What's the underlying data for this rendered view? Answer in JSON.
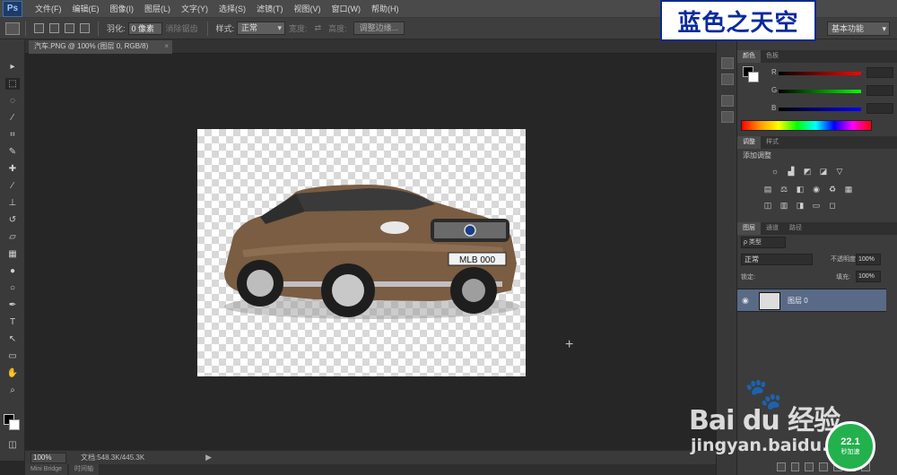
{
  "app": {
    "logo": "Ps"
  },
  "menu": [
    "文件(F)",
    "编辑(E)",
    "图像(I)",
    "图层(L)",
    "文字(Y)",
    "选择(S)",
    "滤镜(T)",
    "视图(V)",
    "窗口(W)",
    "帮助(H)"
  ],
  "options": {
    "feather_label": "羽化:",
    "feather_value": "0 像素",
    "antialias": "消除锯齿",
    "style_label": "样式:",
    "style_value": "正常",
    "width_label": "宽度:",
    "height_label": "高度:",
    "refine_edge": "调整边缘...",
    "workspace": "基本功能"
  },
  "title_watermark": "蓝色之天空",
  "document": {
    "tab": "汽车.PNG @ 100% (图层 0, RGB/8)",
    "close": "×"
  },
  "status": {
    "zoom": "100%",
    "doc_size": "文档:548.3K/445.3K",
    "arrow": "▶"
  },
  "bottom_tabs": [
    "Mini Bridge",
    "时间轴"
  ],
  "color_panel": {
    "tabs": [
      "颜色",
      "色板"
    ],
    "sliders": [
      {
        "label": "R",
        "color": "#ff0000"
      },
      {
        "label": "G",
        "color": "#00ff00"
      },
      {
        "label": "B",
        "color": "#0000ff"
      }
    ]
  },
  "adjust_panel": {
    "tabs": [
      "调整",
      "样式"
    ],
    "title": "添加调整"
  },
  "layers_panel": {
    "tabs": [
      "图层",
      "通道",
      "路径"
    ],
    "filter": "ρ 类型",
    "blend": "正常",
    "opacity_label": "不透明度:",
    "opacity": "100%",
    "lock_label": "锁定:",
    "fill_label": "填充:",
    "fill": "100%",
    "layers": [
      {
        "name": "图层 0"
      }
    ]
  },
  "canvas": {
    "license_plate": "MLB 000"
  },
  "watermark": {
    "baidu": "Bai du 经验",
    "url": "jingyan.baidu.com"
  },
  "speed": {
    "value": "22.1",
    "text": "秒加速"
  }
}
